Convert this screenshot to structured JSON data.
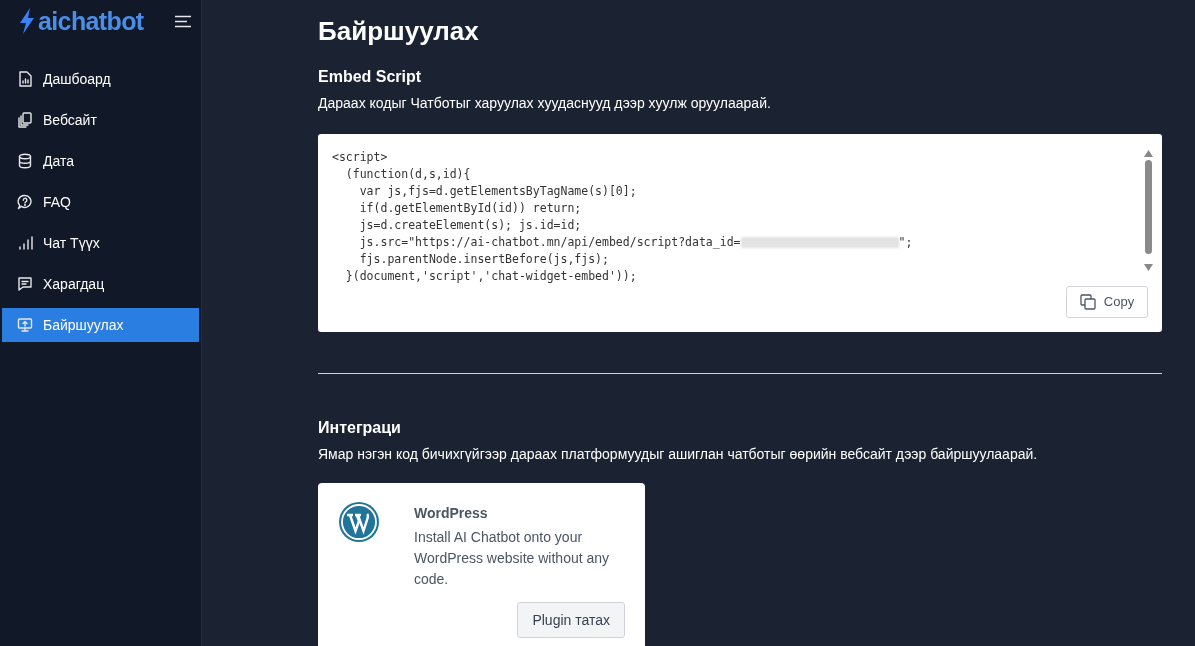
{
  "sidebar": {
    "logo": "aichatbot",
    "items": [
      {
        "label": "Дашбоард",
        "selected": false
      },
      {
        "label": "Вебсайт",
        "selected": false
      },
      {
        "label": "Дата",
        "selected": false
      },
      {
        "label": "FAQ",
        "selected": false
      },
      {
        "label": "Чат Түүх",
        "selected": false
      },
      {
        "label": "Харагдац",
        "selected": false
      },
      {
        "label": "Байршуулах",
        "selected": true
      }
    ]
  },
  "page_title": "Байршуулах",
  "embed": {
    "title": "Embed Script",
    "description": "Дараах кодыг Чатботыг харуулах хуудаснууд дээр хуулж оруулаарай.",
    "code_lines": [
      {
        "kind": "plain",
        "text": "<script>"
      },
      {
        "kind": "plain",
        "text": "  (function(d,s,id){"
      },
      {
        "kind": "plain",
        "text": "    var js,fjs=d.getElementsByTagName(s)[0];"
      },
      {
        "kind": "plain",
        "text": "    if(d.getElementById(id)) return;"
      },
      {
        "kind": "plain",
        "text": "    js=d.createElement(s); js.id=id;"
      },
      {
        "kind": "redacted",
        "text": "    js.src=\"https://ai-chatbot.mn/api/embed/script?data_id=",
        "after": "\";"
      },
      {
        "kind": "plain",
        "text": "    fjs.parentNode.insertBefore(js,fjs);"
      },
      {
        "kind": "plain",
        "text": "  }(document,'script','chat-widget-embed'));"
      }
    ],
    "copy_label": "Copy"
  },
  "integrations": {
    "title": "Интеграци",
    "description": "Ямар нэгэн код бичихгүйгээр дараах платформуудыг ашиглан чатботыг өөрийн вебсайт дээр байршуулаарай.",
    "cards": [
      {
        "title": "WordPress",
        "description": "Install AI Chatbot onto your WordPress website without any code.",
        "button": "Plugin татах"
      }
    ]
  }
}
